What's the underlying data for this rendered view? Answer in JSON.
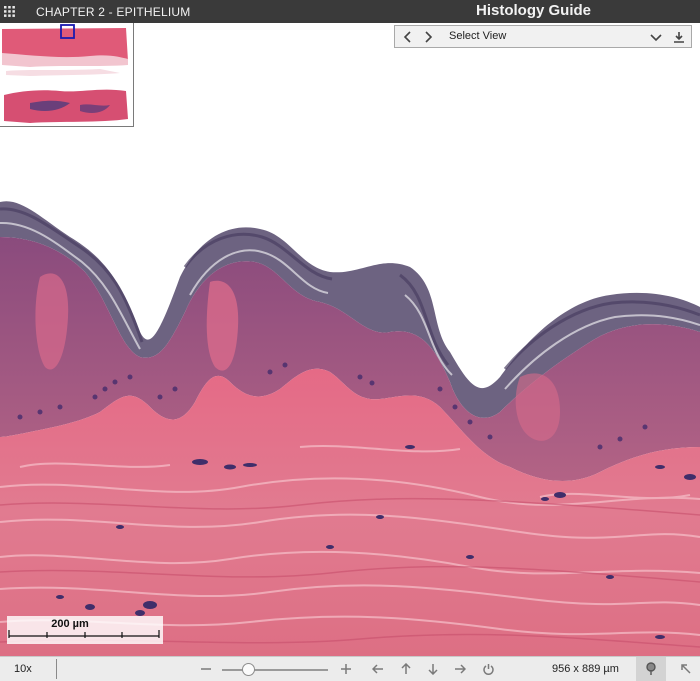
{
  "header": {
    "chapter": "CHAPTER 2 - EPITHELIUM",
    "brand": "Histology Guide",
    "menu_icon": "grid-menu-icon"
  },
  "view_selector": {
    "label": "Select View",
    "icons": [
      "chevron-left-icon",
      "chevron-right-icon",
      "chevron-down-icon",
      "download-icon"
    ]
  },
  "scale_bar": {
    "label": "200 µm"
  },
  "footer": {
    "zoom": "10x",
    "zoom_slider_level": 0.25,
    "dimensions": "956 x 889 µm",
    "icons": [
      "zoom-out-icon",
      "zoom-in-icon",
      "arrow-left-icon",
      "arrow-up-icon",
      "arrow-down-icon",
      "arrow-right-icon",
      "power-icon",
      "pin-icon",
      "expand-icon"
    ]
  },
  "colors": {
    "topbar": "#3a3a3a",
    "dermis": "#e5788e",
    "epidermis": "#a3597f",
    "keratin": "#6d6381",
    "nuclei": "#3f2e6a",
    "bottombar": "#ececec"
  }
}
